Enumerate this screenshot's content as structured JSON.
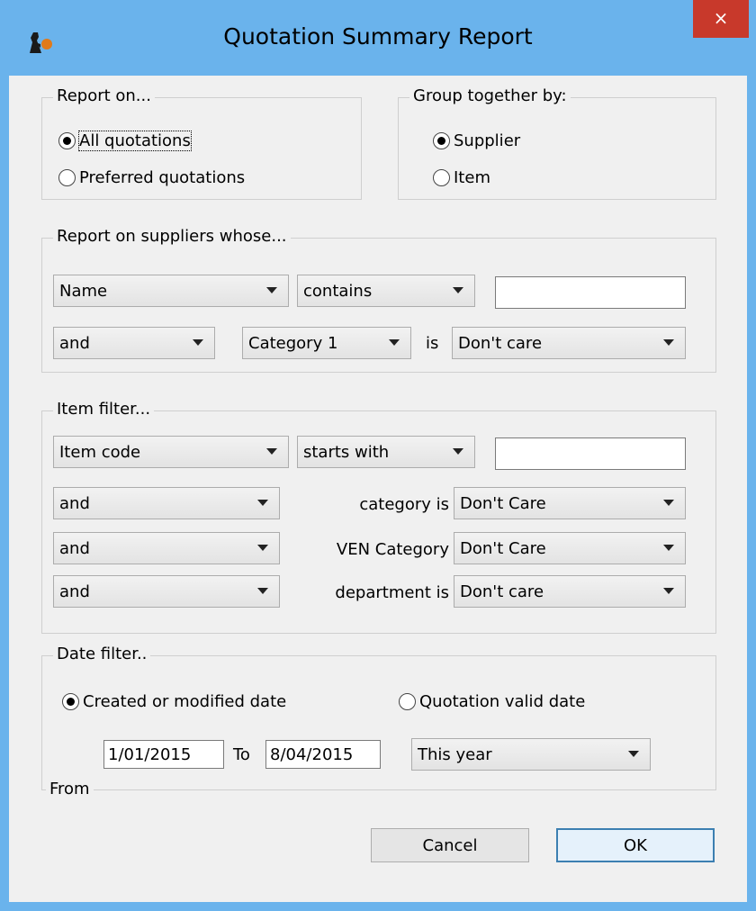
{
  "window": {
    "title": "Quotation Summary Report",
    "close_label": "×"
  },
  "report_on": {
    "legend": "Report on...",
    "options": [
      "All quotations",
      "Preferred quotations"
    ],
    "selected": "All quotations"
  },
  "group_by": {
    "legend": "Group together by:",
    "options": [
      "Supplier",
      "Item"
    ],
    "selected": "Supplier"
  },
  "supplier_filter": {
    "legend": "Report on suppliers whose...",
    "field": "Name",
    "operator": "contains",
    "value": "",
    "conjunction": "and",
    "category": "Category 1",
    "is_label": "is",
    "category_value": "Don't care"
  },
  "item_filter": {
    "legend": "Item filter...",
    "field": "Item code",
    "operator": "starts with",
    "value": "",
    "rows": [
      {
        "conjunction": "and",
        "label": "category is",
        "value": "Don't Care"
      },
      {
        "conjunction": "and",
        "label": "VEN Category",
        "value": "Don't Care"
      },
      {
        "conjunction": "and",
        "label": "department is",
        "value": "Don't care"
      }
    ]
  },
  "date_filter": {
    "legend": "Date filter..",
    "options": [
      "Created or modified date",
      "Quotation valid date"
    ],
    "selected": "Created or modified date",
    "from_value": "1/01/2015",
    "to_label": "To",
    "to_value": "8/04/2015",
    "period": "This year",
    "from_label": "From"
  },
  "buttons": {
    "cancel": "Cancel",
    "ok": "OK"
  }
}
